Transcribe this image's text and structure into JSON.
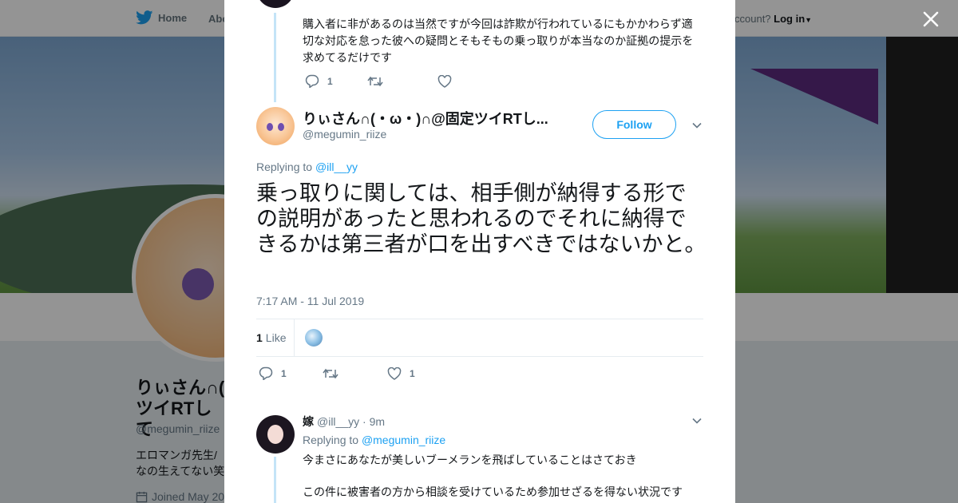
{
  "nav": {
    "home_label": "Home",
    "about_label": "Abo",
    "account_prompt": "ccount?",
    "login_label": "Log in"
  },
  "profile": {
    "name_line1": "りぃさん∩(",
    "name_line2": "ツイRTして",
    "handle": "@megumin_riize",
    "bio_line1": "エロマンガ先生/",
    "bio_line2": "なの生えてない笑",
    "joined": "Joined May 20"
  },
  "previous_tweet": {
    "text": "購入者に非があるのは当然ですが今回は詐欺が行われているにもかかわらず適切な対応を怠った彼への疑問とそもそもの乗っ取りが本当なのか証拠の提示を求めてるだけです",
    "reply_count": "1",
    "retweet_count": "",
    "like_count": ""
  },
  "main_tweet": {
    "author_name": "りぃさん∩(・ω・)∩@固定ツイRTし...",
    "author_handle": "@megumin_riize",
    "follow_label": "Follow",
    "replying_prefix": "Replying to",
    "replying_to": "@ill__yy",
    "text": "乗っ取りに関しては、相手側が納得する形での説明があったと思われるのでそれに納得できるかは第三者が口を出すべきではないかと。",
    "timestamp": "7:17 AM - 11 Jul 2019",
    "like_stat_count": "1",
    "like_stat_label": "Like",
    "reply_count": "1",
    "retweet_count": "",
    "like_count": "1"
  },
  "reply_tweet": {
    "author_name": "嫁",
    "author_handle": "@ill__yy",
    "time": "· 9m",
    "replying_prefix": "Replying to",
    "replying_to": "@megumin_riize",
    "line1": "今まさにあなたが美しいブーメランを飛ばしていることはさておき",
    "line2": "この件に被害者の方から相談を受けているため参加せざるを得ない状況です"
  },
  "icons": [
    "twitter-bird-icon",
    "close-icon",
    "reply-icon",
    "retweet-icon",
    "heart-icon",
    "chevron-down-icon",
    "calendar-icon"
  ],
  "colors": {
    "accent": "#1da1f2",
    "thread_line": "#c4e4f7",
    "text": "#14171a",
    "muted": "#657786"
  }
}
